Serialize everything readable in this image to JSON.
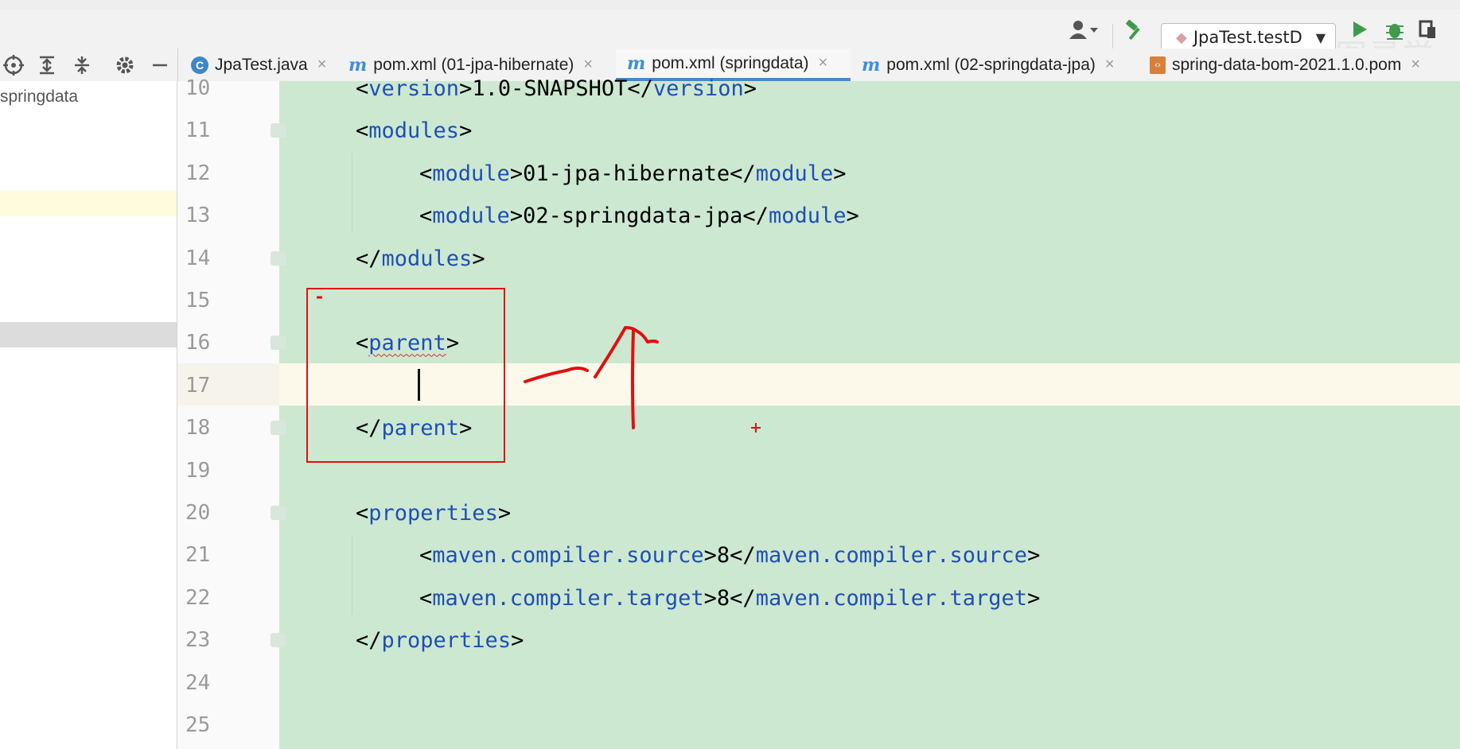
{
  "toolbar": {
    "run_config_label": "JpaTest.testD",
    "icons": [
      "user-dropdown-icon",
      "build-hammer-icon",
      "run-play-icon",
      "debug-bug-icon",
      "coverage-icon"
    ],
    "watermark": "图灵学"
  },
  "project_panel": {
    "icons": [
      "target-icon",
      "expand-all-icon",
      "collapse-all-icon",
      "gear-icon",
      "minimize-icon"
    ],
    "root_label": "springdata"
  },
  "tabs": [
    {
      "label": "JpaTest.java",
      "icon": "java-class-icon",
      "active": false
    },
    {
      "label": "pom.xml (01-jpa-hibernate)",
      "icon": "maven-icon",
      "active": false
    },
    {
      "label": "pom.xml (springdata)",
      "icon": "maven-icon",
      "active": true
    },
    {
      "label": "pom.xml (02-springdata-jpa)",
      "icon": "maven-icon",
      "active": false
    },
    {
      "label": "spring-data-bom-2021.1.0.pom",
      "icon": "pom-file-icon",
      "active": false
    }
  ],
  "editor": {
    "lines": [
      {
        "n": "10",
        "parts": [
          [
            "punc",
            "<"
          ],
          [
            "tag",
            "version"
          ],
          [
            "punc",
            ">"
          ],
          [
            "txt",
            "1.0-SNAPSHOT"
          ],
          [
            "punc",
            "</"
          ],
          [
            "tag",
            "version"
          ],
          [
            "punc",
            ">"
          ]
        ]
      },
      {
        "n": "11",
        "parts": [
          [
            "punc",
            "<"
          ],
          [
            "tag",
            "modules"
          ],
          [
            "punc",
            ">"
          ]
        ]
      },
      {
        "n": "12",
        "parts": [
          [
            "punc",
            "<"
          ],
          [
            "tag",
            "module"
          ],
          [
            "punc",
            ">"
          ],
          [
            "txt",
            "01-jpa-hibernate"
          ],
          [
            "punc",
            "</"
          ],
          [
            "tag",
            "module"
          ],
          [
            "punc",
            ">"
          ]
        ]
      },
      {
        "n": "13",
        "parts": [
          [
            "punc",
            "<"
          ],
          [
            "tag",
            "module"
          ],
          [
            "punc",
            ">"
          ],
          [
            "txt",
            "02-springdata-jpa"
          ],
          [
            "punc",
            "</"
          ],
          [
            "tag",
            "module"
          ],
          [
            "punc",
            ">"
          ]
        ]
      },
      {
        "n": "14",
        "parts": [
          [
            "punc",
            "</"
          ],
          [
            "tag",
            "modules"
          ],
          [
            "punc",
            ">"
          ]
        ]
      },
      {
        "n": "15",
        "parts": []
      },
      {
        "n": "16",
        "parts": [
          [
            "punc",
            "<"
          ],
          [
            "tag",
            "parent"
          ],
          [
            "punc",
            ">"
          ]
        ]
      },
      {
        "n": "17",
        "parts": []
      },
      {
        "n": "18",
        "parts": [
          [
            "punc",
            "</"
          ],
          [
            "tag",
            "parent"
          ],
          [
            "punc",
            ">"
          ]
        ]
      },
      {
        "n": "19",
        "parts": []
      },
      {
        "n": "20",
        "parts": [
          [
            "punc",
            "<"
          ],
          [
            "tag",
            "properties"
          ],
          [
            "punc",
            ">"
          ]
        ]
      },
      {
        "n": "21",
        "parts": [
          [
            "punc",
            "<"
          ],
          [
            "tag",
            "maven.compiler.source"
          ],
          [
            "punc",
            ">"
          ],
          [
            "txt",
            "8"
          ],
          [
            "punc",
            "</"
          ],
          [
            "tag",
            "maven.compiler.source"
          ],
          [
            "punc",
            ">"
          ]
        ]
      },
      {
        "n": "22",
        "parts": [
          [
            "punc",
            "<"
          ],
          [
            "tag",
            "maven.compiler.target"
          ],
          [
            "punc",
            ">"
          ],
          [
            "txt",
            "8"
          ],
          [
            "punc",
            "</"
          ],
          [
            "tag",
            "maven.compiler.target"
          ],
          [
            "punc",
            ">"
          ]
        ]
      },
      {
        "n": "23",
        "parts": [
          [
            "punc",
            "</"
          ],
          [
            "tag",
            "properties"
          ],
          [
            "punc",
            ">"
          ]
        ]
      },
      {
        "n": "24",
        "parts": []
      },
      {
        "n": "25",
        "parts": []
      }
    ]
  },
  "colors": {
    "editor_bg": "#cde8d1",
    "current_line": "#fdf9ea",
    "tag": "#1e4fb5",
    "annotation": "#e01010",
    "active_tab_underline": "#4a88c7"
  }
}
